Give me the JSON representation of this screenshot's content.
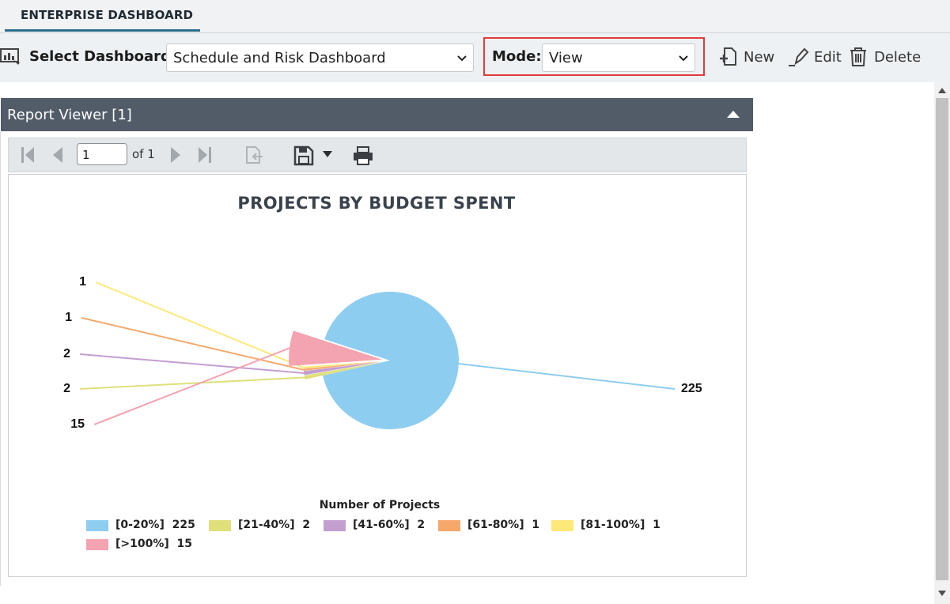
{
  "tab": {
    "label": "ENTERPRISE DASHBOARD"
  },
  "toolbar": {
    "select_dashboard_label": "Select Dashboard:",
    "dashboard_value": "Schedule and Risk Dashboard",
    "mode_label": "Mode:",
    "mode_value": "View",
    "new_label": "New",
    "edit_label": "Edit",
    "delete_label": "Delete",
    "highlight_color": "#e23b3b"
  },
  "panel": {
    "title": "Report Viewer [1]"
  },
  "viewer": {
    "page_value": "1",
    "of_label": "of 1"
  },
  "chart_data": {
    "type": "pie",
    "title": "PROJECTS BY BUDGET SPENT",
    "legend_title": "Number of Projects",
    "slices": [
      {
        "name": "[0-20%]",
        "value": 225,
        "color": "#8dcdf0",
        "label": "225"
      },
      {
        "name": "[21-40%]",
        "value": 2,
        "color": "#dfe07a",
        "label": "2"
      },
      {
        "name": "[41-60%]",
        "value": 2,
        "color": "#c39fd0",
        "label": "2"
      },
      {
        "name": "[61-80%]",
        "value": 1,
        "color": "#f6a86b",
        "label": "1"
      },
      {
        "name": "[81-100%]",
        "value": 1,
        "color": "#fce97a",
        "label": "1"
      },
      {
        "name": "[>100%]",
        "value": 15,
        "color": "#f4a3b1",
        "label": "15"
      }
    ]
  }
}
